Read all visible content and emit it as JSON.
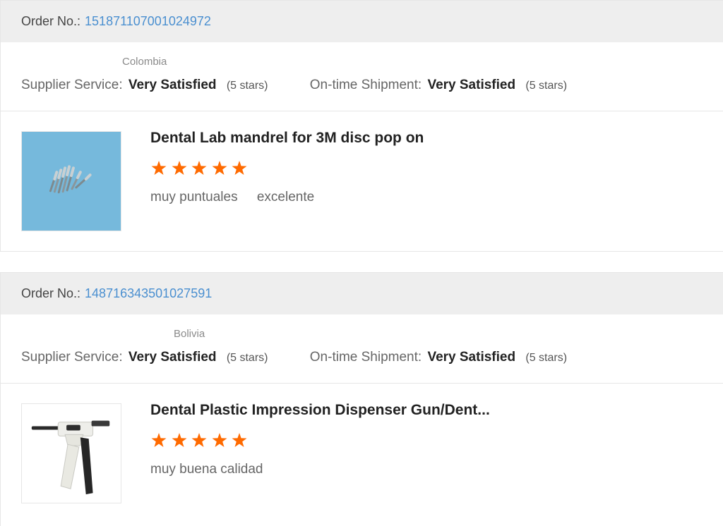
{
  "colors": {
    "header_bg": "#eeeeee",
    "link_blue": "#4a8fd0",
    "star_orange": "#ff6a00",
    "thumb_blue": "#76b9dc",
    "border": "#e6e6e6"
  },
  "orders": [
    {
      "order_label": "Order No.:",
      "order_number": "151871107001024972",
      "country": "Colombia",
      "supplier_service": {
        "label": "Supplier Service:",
        "value": "Very Satisfied",
        "stars": "(5 stars)"
      },
      "shipment": {
        "label": "On-time Shipment:",
        "value": "Very Satisfied",
        "stars": "(5 stars)"
      },
      "product": {
        "title": "Dental Lab mandrel for 3M disc pop on",
        "thumbnail_icon": "mandrel-burs-image",
        "rating": 5,
        "rating_max": 5,
        "tags": [
          "muy puntuales",
          "excelente"
        ]
      }
    },
    {
      "order_label": "Order No.:",
      "order_number": "148716343501027591",
      "country": "Bolivia",
      "supplier_service": {
        "label": "Supplier Service:",
        "value": "Very Satisfied",
        "stars": "(5 stars)"
      },
      "shipment": {
        "label": "On-time Shipment:",
        "value": "Very Satisfied",
        "stars": "(5 stars)"
      },
      "product": {
        "title": "Dental Plastic Impression Dispenser Gun/Dent...",
        "thumbnail_icon": "dispenser-gun-image",
        "rating": 5,
        "rating_max": 5,
        "tags": [
          "muy buena calidad"
        ]
      }
    }
  ]
}
